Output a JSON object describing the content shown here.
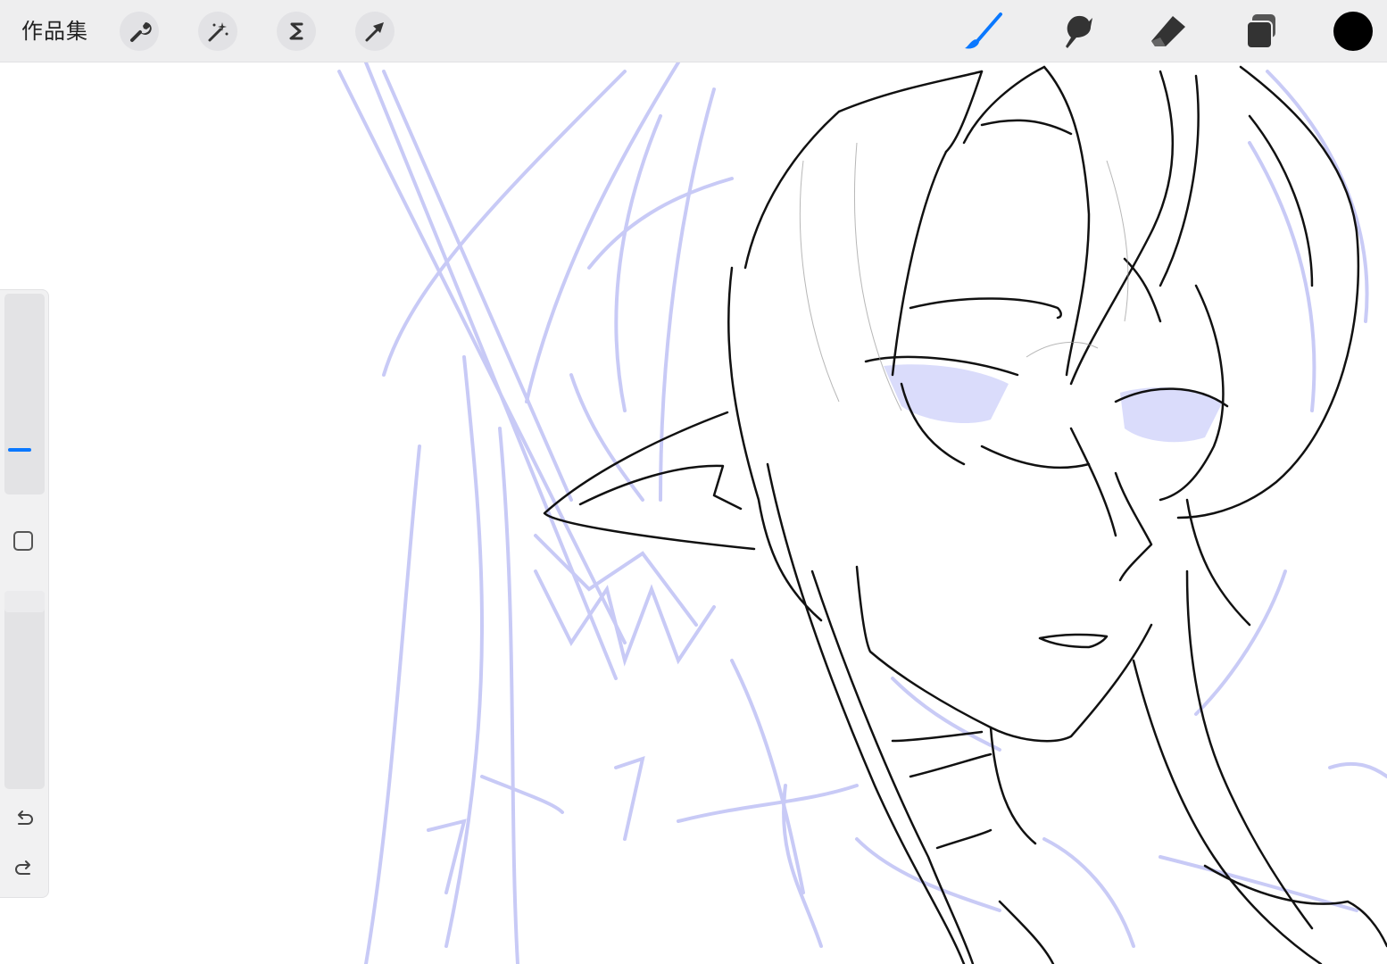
{
  "toolbar": {
    "gallery_label": "作品集",
    "actions_icon": "wrench-icon",
    "adjustments_icon": "magic-wand-icon",
    "selection_icon": "selection-s-icon",
    "transform_icon": "arrow-cursor-icon",
    "brush_icon": "brush-icon",
    "smudge_icon": "smudge-icon",
    "eraser_icon": "eraser-icon",
    "layers_icon": "layers-icon",
    "current_color": "#000000",
    "active_tool_color": "#0a78ff"
  },
  "sidebar": {
    "brush_size_icon": "brush-size-slider",
    "modify_icon": "square-modify-icon",
    "opacity_icon": "opacity-slider",
    "undo_icon": "undo-icon",
    "redo_icon": "redo-icon"
  },
  "canvas": {
    "sketch_color": "#c6c8f6",
    "line_color": "#111111"
  }
}
